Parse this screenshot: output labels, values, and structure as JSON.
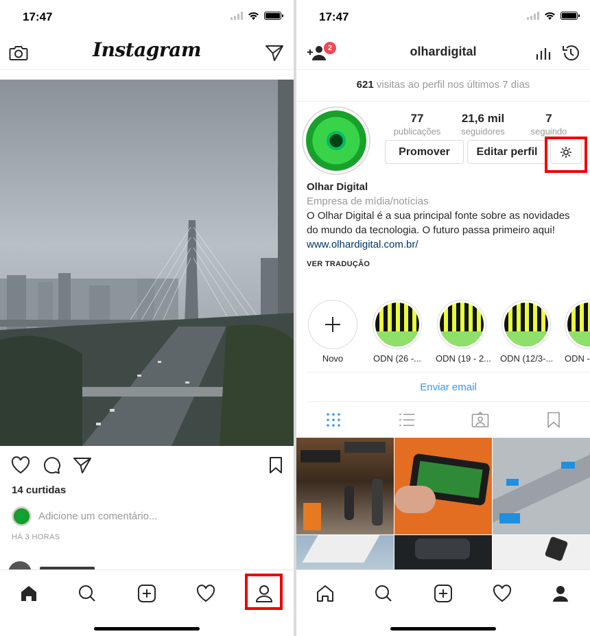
{
  "status": {
    "time": "17:47"
  },
  "left": {
    "app_logo": "Instagram",
    "post": {
      "likes": "14 curtidas",
      "comment_placeholder": "Adicione um comentário...",
      "time_ago": "HÁ 3 HORAS"
    }
  },
  "right": {
    "username": "olhardigital",
    "notification_count": "2",
    "visits": {
      "count": "621",
      "text": "visitas ao perfil nos últimos 7 dias"
    },
    "stats": [
      {
        "number": "77",
        "label": "publicações"
      },
      {
        "number": "21,6 mil",
        "label": "seguidores"
      },
      {
        "number": "7",
        "label": "seguindo"
      }
    ],
    "buttons": {
      "promote": "Promover",
      "edit_profile": "Editar perfil"
    },
    "bio": {
      "name": "Olhar Digital",
      "category": "Empresa de mídia/notícias",
      "description": "O Olhar Digital é a sua principal fonte sobre as novidades do mundo da tecnologia. O futuro passa primeiro aqui!",
      "link": "www.olhardigital.com.br/",
      "translate": "VER TRADUÇÃO"
    },
    "highlights": [
      {
        "label": "Novo"
      },
      {
        "label": "ODN (26 -..."
      },
      {
        "label": "ODN (19 - 2..."
      },
      {
        "label": "ODN (12/3-..."
      },
      {
        "label": "ODN -"
      }
    ],
    "email_button": "Enviar email"
  },
  "colors": {
    "accent_blue": "#3897f0",
    "highlight_red": "#e00000",
    "badge_red": "#ed4956",
    "link_blue": "#003569"
  }
}
